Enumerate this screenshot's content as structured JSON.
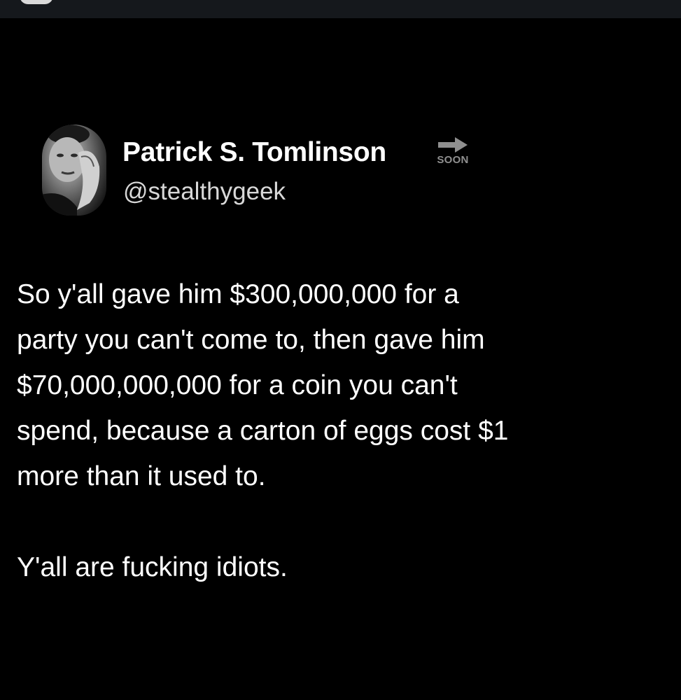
{
  "colors": {
    "background": "#000000",
    "top_bar": "#15181c",
    "text_primary": "#ffffff",
    "text_secondary": "#d8d8d8",
    "badge": "#8f8f8f"
  },
  "tweet": {
    "author": {
      "display_name": "Patrick S. Tomlinson",
      "handle": "@stealthygeek",
      "avatar_icon": "avatar-photo",
      "badge_icon": "arrow-right-icon",
      "badge_label": "SOON"
    },
    "text_lines": [
      "So y'all gave him $300,000,000 for a",
      "party you can't come to, then gave him",
      "$70,000,000,000 for a coin you can't",
      "spend, because a carton of eggs cost $1",
      "more than it used to."
    ],
    "closing_line": "Y'all are fucking idiots."
  }
}
